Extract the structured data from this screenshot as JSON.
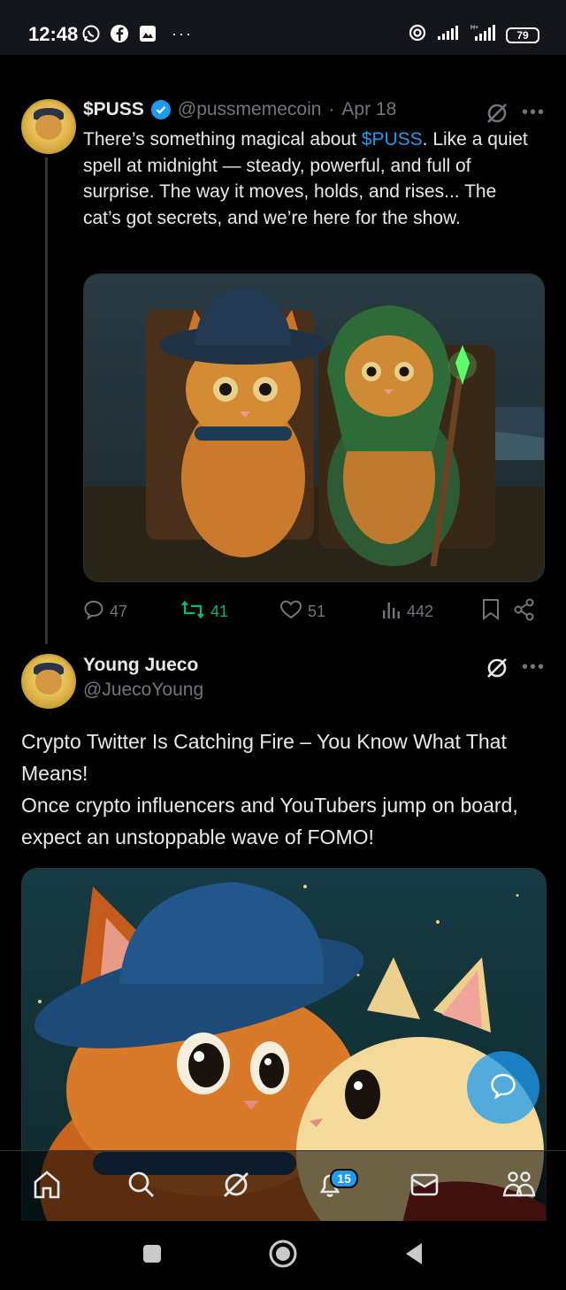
{
  "status_bar": {
    "time": "12:48",
    "battery": "79",
    "left_icons": [
      "whatsapp-icon",
      "facebook-icon",
      "gallery-icon"
    ],
    "more": "···"
  },
  "post1": {
    "name": "$PUSS",
    "handle": "@pussmemecoin",
    "separator": "·",
    "date": "Apr 18",
    "text_before_link": "There’s something magical about ",
    "text_link": "$PUSS",
    "text_after_link": ". Like a quiet spell at midnight — steady, powerful, and full of surprise. The way it moves, holds, and rises... The cat’s got secrets, and we’re here for the show.",
    "stats": {
      "replies": "47",
      "reposts": "41",
      "likes": "51",
      "views": "442"
    }
  },
  "post2": {
    "name": "Young Jueco",
    "handle": "@JuecoYoung",
    "line1": "Crypto Twitter Is Catching Fire – You Know What That Means!",
    "line2": "Once crypto influencers and YouTubers jump on board, expect an unstoppable wave of FOMO!"
  },
  "tabs": {
    "notifications_badge": "15"
  },
  "colors": {
    "accent": "#1d9bf0",
    "repost_active": "#00ba7c",
    "muted": "#71767b",
    "text": "#e7e9ea"
  }
}
